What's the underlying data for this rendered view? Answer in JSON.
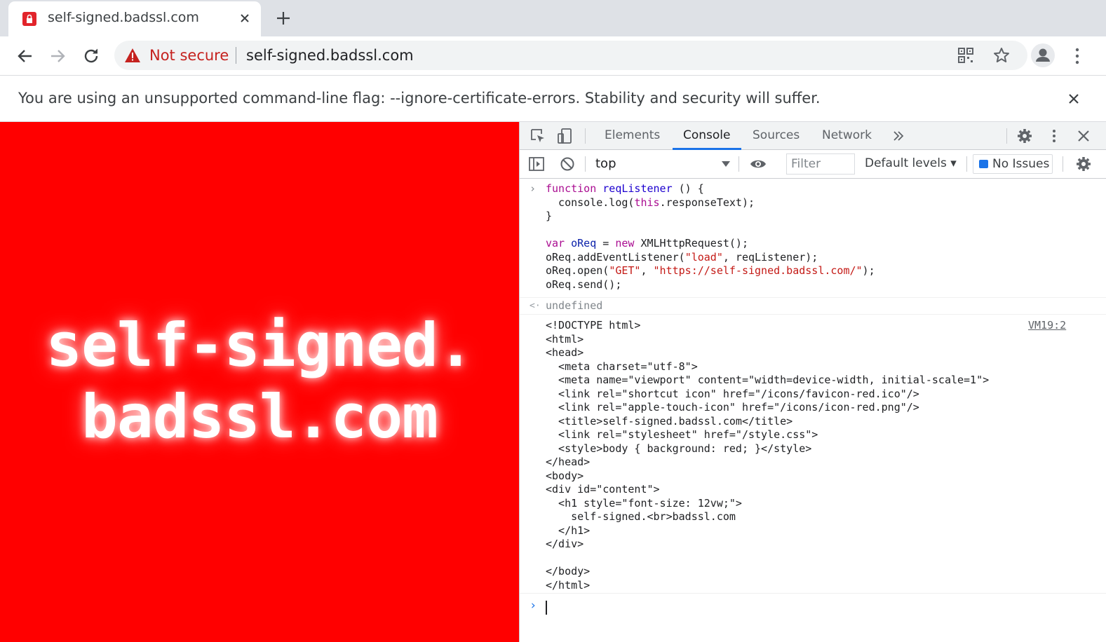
{
  "tab": {
    "title": "self-signed.badssl.com"
  },
  "omnibox": {
    "security_label": "Not secure",
    "url": "self-signed.badssl.com"
  },
  "infobar": {
    "text": "You are using an unsupported command-line flag: --ignore-certificate-errors. Stability and security will suffer."
  },
  "page": {
    "heading_line1": "self-signed.",
    "heading_line2": "badssl.com",
    "background": "#ff0000"
  },
  "devtools": {
    "tabs": [
      "Elements",
      "Console",
      "Sources",
      "Network"
    ],
    "active_tab": "Console",
    "context": "top",
    "filter_placeholder": "Filter",
    "levels": "Default levels",
    "issues": "No Issues",
    "undefined_text": "undefined",
    "source_link": "VM19:2",
    "input_lines": [
      "function reqListener () {",
      "  console.log(this.responseText);",
      "}",
      "",
      "var oReq = new XMLHttpRequest();",
      "oReq.addEventListener(\"load\", reqListener);",
      "oReq.open(\"GET\", \"https://self-signed.badssl.com/\");",
      "oReq.send();"
    ],
    "output_lines": [
      "<!DOCTYPE html>",
      "<html>",
      "<head>",
      "  <meta charset=\"utf-8\">",
      "  <meta name=\"viewport\" content=\"width=device-width, initial-scale=1\">",
      "  <link rel=\"shortcut icon\" href=\"/icons/favicon-red.ico\"/>",
      "  <link rel=\"apple-touch-icon\" href=\"/icons/icon-red.png\"/>",
      "  <title>self-signed.badssl.com</title>",
      "  <link rel=\"stylesheet\" href=\"/style.css\">",
      "  <style>body { background: red; }</style>",
      "</head>",
      "<body>",
      "<div id=\"content\">",
      "  <h1 style=\"font-size: 12vw;\">",
      "    self-signed.<br>badssl.com",
      "  </h1>",
      "</div>",
      "",
      "</body>",
      "</html>"
    ]
  }
}
